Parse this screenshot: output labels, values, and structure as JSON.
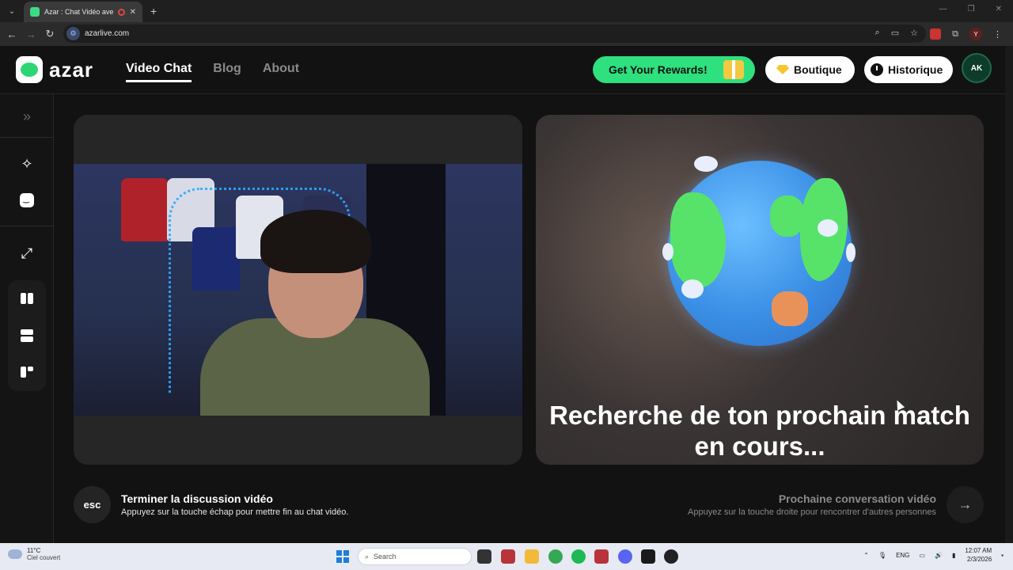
{
  "browser": {
    "tab_title": "Azar : Chat Vidéo avec de n",
    "url": "azarlive.com",
    "profile_initial": "Y"
  },
  "header": {
    "logo_text": "azar",
    "nav": [
      "Video Chat",
      "Blog",
      "About"
    ],
    "rewards_label": "Get Your Rewards!",
    "boutique_label": "Boutique",
    "historique_label": "Historique",
    "avatar_text": "AK"
  },
  "sidebar": {
    "icons": [
      "expand-icon",
      "magic-wand-icon",
      "face-filter-icon",
      "fullscreen-icon",
      "layout-split-icon",
      "layout-stack-icon",
      "layout-mix-icon"
    ]
  },
  "match": {
    "searching_text": "Recherche de ton prochain match en cours..."
  },
  "controls": {
    "esc_label": "esc",
    "end_title": "Terminer la discussion vidéo",
    "end_sub": "Appuyez sur la touche échap pour mettre fin au chat vidéo.",
    "next_title": "Prochaine conversation vidéo",
    "next_sub": "Appuyez sur la touche droite pour rencontrer d'autres personnes"
  },
  "taskbar": {
    "temp": "11°C",
    "weather": "Ciel couvert",
    "search_label": "Search",
    "lang": "ENG",
    "time": "12:07 AM",
    "date": "2/3/2026"
  },
  "colors": {
    "accent_green": "#2ee07e",
    "background": "#121212"
  }
}
